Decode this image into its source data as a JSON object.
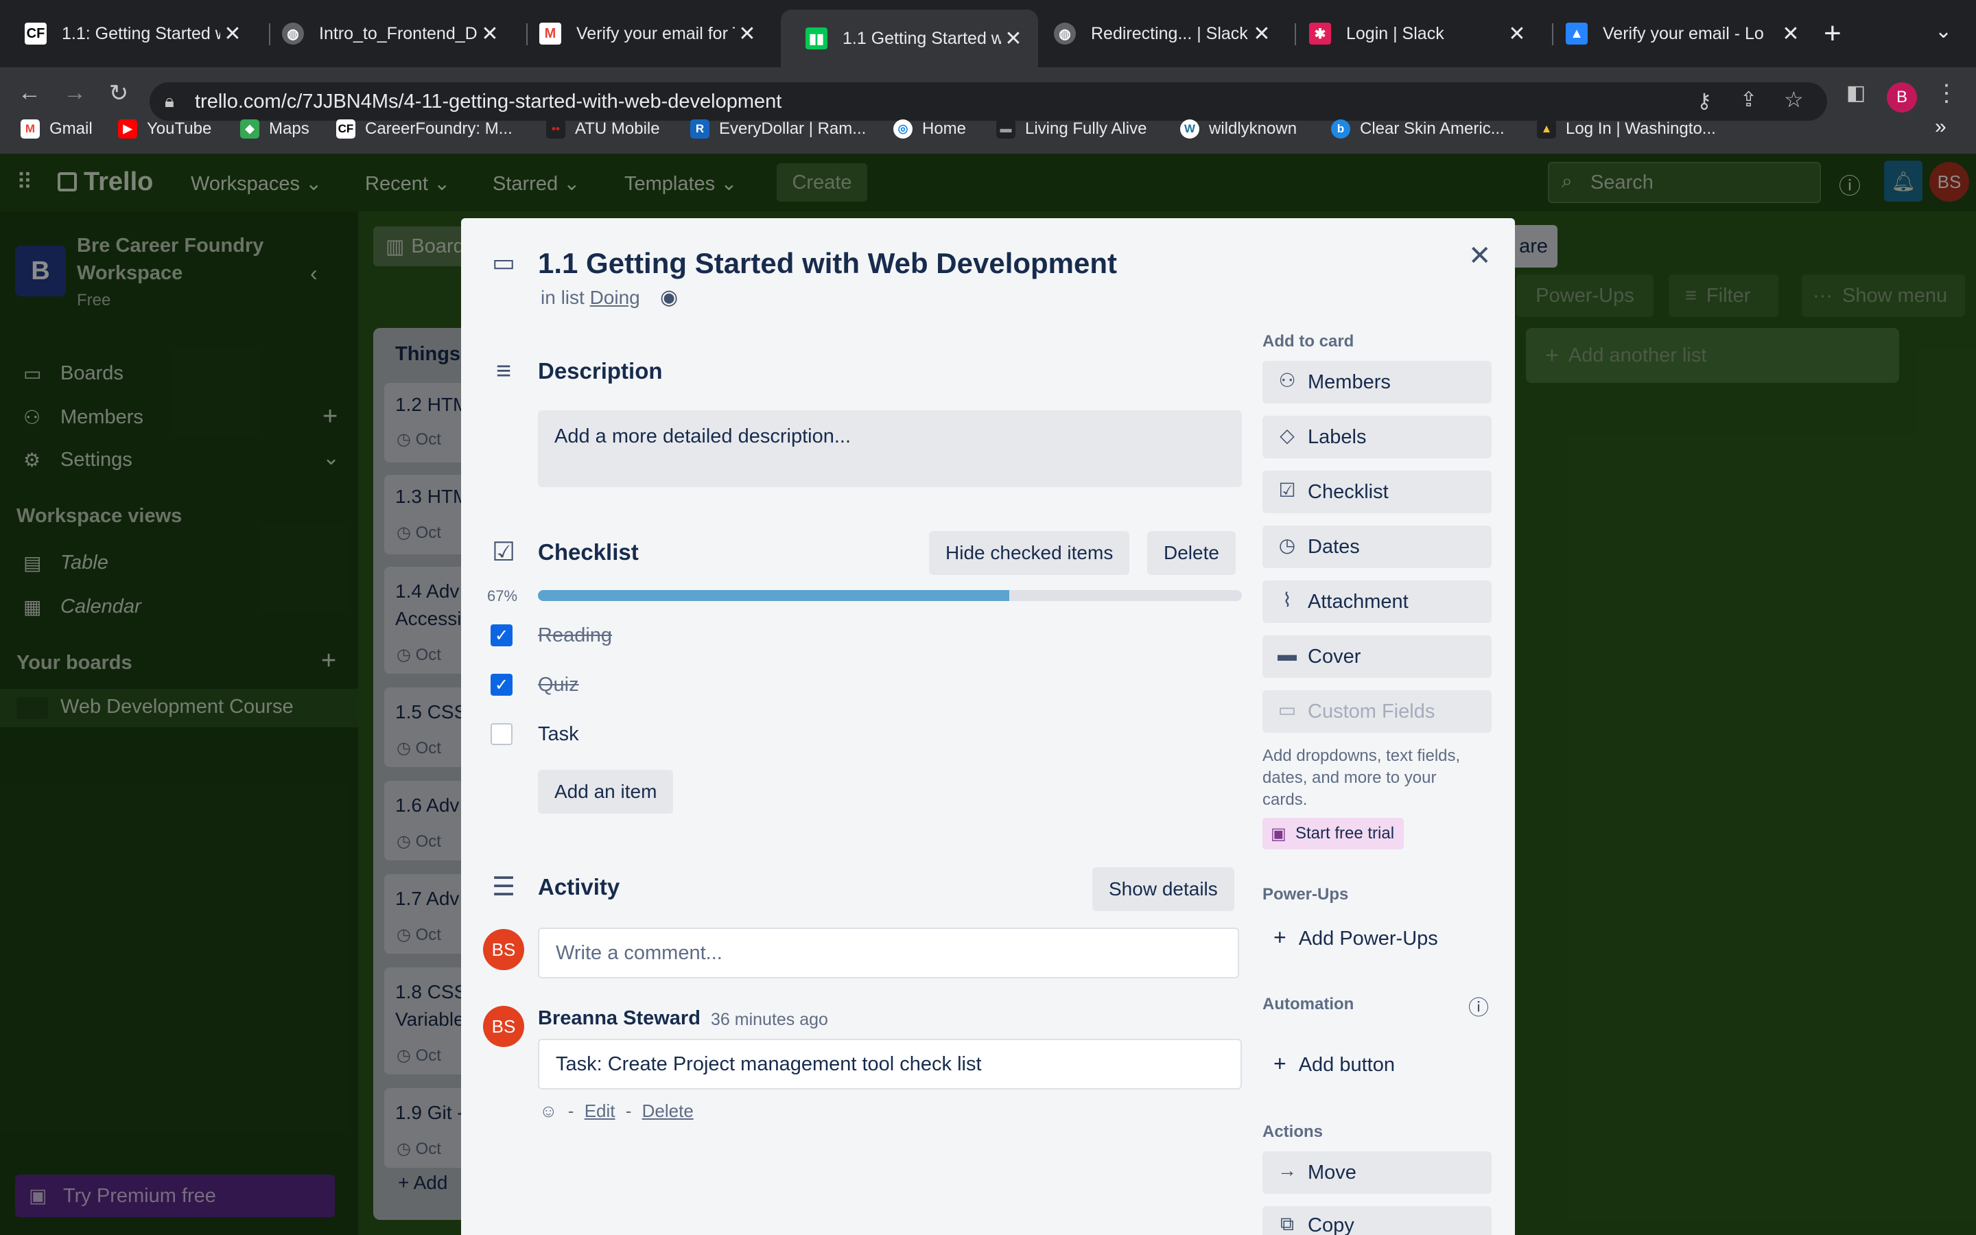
{
  "browser": {
    "tabs": [
      {
        "title": "1.1: Getting Started w",
        "favicon": "CF",
        "favicon_color": "#000000"
      },
      {
        "title": "Intro_to_Frontend_De",
        "favicon": "globe-icon",
        "favicon_color": "#5f6368"
      },
      {
        "title": "Verify your email for T",
        "favicon": "M",
        "favicon_color": "#ea4335"
      },
      {
        "title": "1.1 Getting Started wi",
        "favicon": "trello-icon",
        "favicon_color": "#00c853"
      },
      {
        "title": "Redirecting... | Slack",
        "favicon": "globe-icon",
        "favicon_color": "#5f6368"
      },
      {
        "title": "Login | Slack",
        "favicon": "slack-icon",
        "favicon_color": "#e01e5a"
      },
      {
        "title": "Verify your email - Lo",
        "favicon": "atlassian-icon",
        "favicon_color": "#2684ff"
      }
    ],
    "url": "trello.com/c/7JJBN4Ms/4-11-getting-started-with-web-development",
    "bookmarks": [
      {
        "label": "Gmail",
        "icon": "M",
        "color": "#ea4335"
      },
      {
        "label": "YouTube",
        "icon": "▶",
        "color": "#ff0000"
      },
      {
        "label": "Maps",
        "icon": "◆",
        "color": "#34a853"
      },
      {
        "label": "CareerFoundry: M...",
        "icon": "CF",
        "color": "#000000"
      },
      {
        "label": "ATU Mobile",
        "icon": "••",
        "color": "#c62828"
      },
      {
        "label": "EveryDollar | Ram...",
        "icon": "R",
        "color": "#1565c0"
      },
      {
        "label": "Home",
        "icon": "◎",
        "color": "#1e88e5"
      },
      {
        "label": "Living Fully Alive",
        "icon": "▬",
        "color": "#37474f"
      },
      {
        "label": "wildlyknown",
        "icon": "W",
        "color": "#21759b"
      },
      {
        "label": "Clear Skin Americ...",
        "icon": "b",
        "color": "#1e88e5"
      },
      {
        "label": "Log In | Washingto...",
        "icon": "▲",
        "color": "#fbc02d"
      }
    ],
    "profile_initial": "B"
  },
  "trello_header": {
    "logo": "Trello",
    "nav": [
      "Workspaces",
      "Recent",
      "Starred",
      "Templates"
    ],
    "create": "Create",
    "search_placeholder": "Search",
    "avatar": "BS"
  },
  "sidebar": {
    "workspace_initial": "B",
    "workspace_name_line1": "Bre Career Foundry",
    "workspace_name_line2": "Workspace",
    "plan": "Free",
    "items": [
      "Boards",
      "Members",
      "Settings"
    ],
    "views_heading": "Workspace views",
    "views": [
      "Table",
      "Calendar"
    ],
    "boards_heading": "Your boards",
    "boards": [
      "Web Development Course"
    ],
    "premium": "Try Premium free"
  },
  "board": {
    "board_tab": "Board",
    "share": "are",
    "powerups": "Power-Ups",
    "filter": "Filter",
    "show_menu": "Show menu",
    "add_list": "Add another list",
    "list_title": "Things",
    "cards": [
      {
        "title": "1.2 HTM",
        "date": "Oct"
      },
      {
        "title": "1.3 HTM",
        "date": "Oct"
      },
      {
        "title": "1.4 Adv",
        "title2": "Accessi",
        "date": "Oct"
      },
      {
        "title": "1.5 CSS",
        "date": "Oct"
      },
      {
        "title": "1.6 Adv",
        "date": "Oct"
      },
      {
        "title": "1.7 Adv",
        "date": "Oct"
      },
      {
        "title": "1.8 CSS",
        "title2": "Variable",
        "date": "Oct"
      },
      {
        "title": "1.9 Git -",
        "date": "Oct"
      }
    ],
    "add_card": "Add"
  },
  "card": {
    "title": "1.1 Getting Started with Web Development",
    "in_list_prefix": "in list",
    "list_name": "Doing",
    "description_heading": "Description",
    "description_placeholder": "Add a more detailed description...",
    "checklist_heading": "Checklist",
    "hide_checked": "Hide checked items",
    "delete": "Delete",
    "progress_label": "67%",
    "progress": 0.67,
    "items": [
      {
        "text": "Reading",
        "checked": true
      },
      {
        "text": "Quiz",
        "checked": true
      },
      {
        "text": "Task",
        "checked": false
      }
    ],
    "add_item": "Add an item",
    "activity_heading": "Activity",
    "show_details": "Show details",
    "comment_placeholder": "Write a comment...",
    "avatar": "BS",
    "comment": {
      "author": "Breanna Steward",
      "time": "36 minutes ago",
      "text": "Task: Create Project management tool check list",
      "edit": "Edit",
      "delete": "Delete"
    }
  },
  "side": {
    "add_to_card": "Add to card",
    "buttons": [
      "Members",
      "Labels",
      "Checklist",
      "Dates",
      "Attachment",
      "Cover"
    ],
    "custom_fields": "Custom Fields",
    "custom_fields_desc": [
      "Add dropdowns, text fields,",
      "dates, and more to your",
      "cards."
    ],
    "free_trial": "Start free trial",
    "powerups_heading": "Power-Ups",
    "add_powerups": "Add Power-Ups",
    "automation_heading": "Automation",
    "add_button": "Add button",
    "actions_heading": "Actions",
    "move": "Move",
    "copy": "Copy"
  }
}
